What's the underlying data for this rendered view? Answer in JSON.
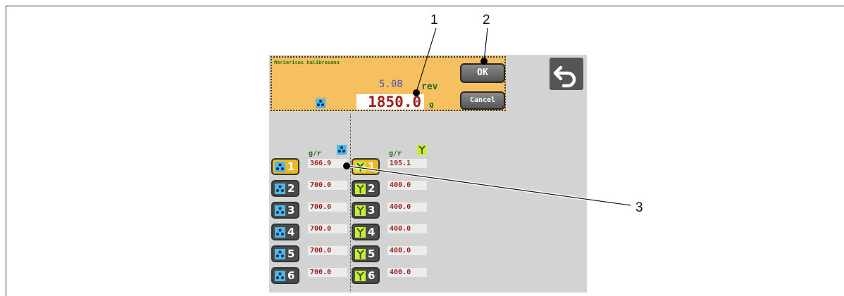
{
  "calibration": {
    "title": "Merierices kalibresana",
    "rev_value": "5.08",
    "rev_unit": "rev",
    "gram_value": "1850.0",
    "gram_unit": "g",
    "ok_label": "OK",
    "cancel_label": "Cancel"
  },
  "columns": {
    "left_header": "g/r",
    "right_header": "g/r"
  },
  "left_rows": [
    {
      "num": "1",
      "value": "366.9",
      "selected": true
    },
    {
      "num": "2",
      "value": "700.0"
    },
    {
      "num": "3",
      "value": "700.0"
    },
    {
      "num": "4",
      "value": "700.0"
    },
    {
      "num": "5",
      "value": "700.0"
    },
    {
      "num": "6",
      "value": "700.0"
    }
  ],
  "right_rows": [
    {
      "num": "1",
      "value": "195.1",
      "selected": true
    },
    {
      "num": "2",
      "value": "400.0"
    },
    {
      "num": "3",
      "value": "400.0"
    },
    {
      "num": "4",
      "value": "400.0"
    },
    {
      "num": "5",
      "value": "400.0"
    },
    {
      "num": "6",
      "value": "400.0"
    }
  ],
  "callouts": [
    "1",
    "2",
    "3"
  ],
  "icons": {
    "left_column": "seed-dots-icon",
    "right_column": "plant-sprout-icon",
    "back": "undo-arrow-icon"
  },
  "colors": {
    "panel": "#f6bf5f",
    "seed_icon": "#4cb8e6",
    "plant_icon": "#c8ee3a",
    "value_text": "#a01e1e",
    "selected_button": "#f0b820"
  }
}
